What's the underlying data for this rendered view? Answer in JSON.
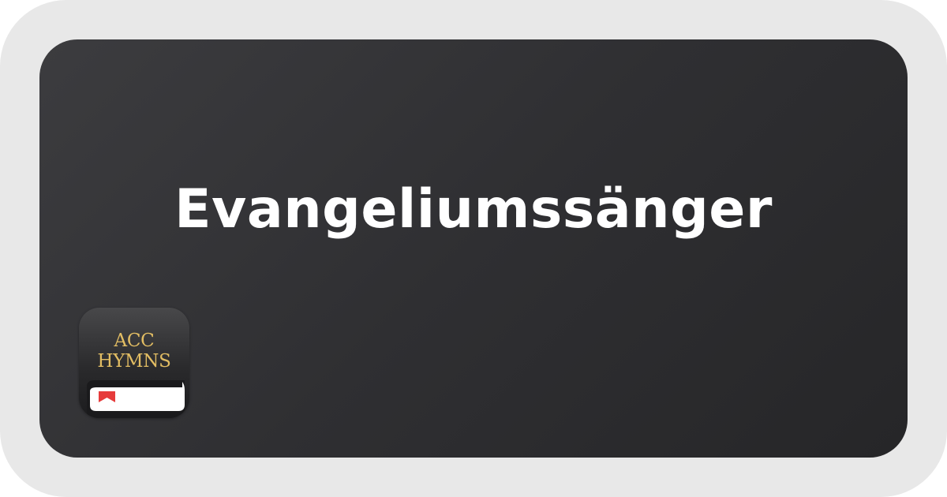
{
  "card": {
    "title": "Evangeliumssänger"
  },
  "app_icon": {
    "line1": "ACC",
    "line2": "HYMNS",
    "text_color": "#e2bd63",
    "bookmark_color": "#e63b3b"
  },
  "colors": {
    "outer_frame": "#e8e8e8",
    "card_background": "#333336",
    "title_text": "#ffffff"
  }
}
